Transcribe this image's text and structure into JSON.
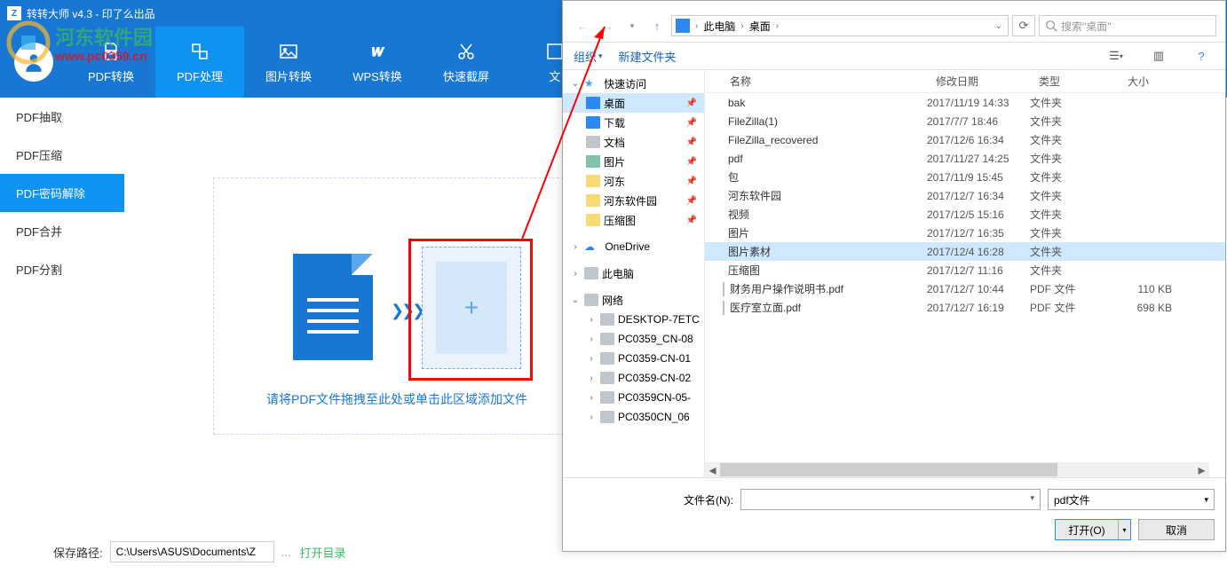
{
  "app": {
    "title": "转转大师 v4.3 - 印了么出品",
    "watermark_site": "河东软件园",
    "watermark_url": "www.pc0359.cn"
  },
  "topnav": [
    {
      "label": "PDF转换",
      "key": "pdf-convert"
    },
    {
      "label": "PDF处理",
      "key": "pdf-process",
      "active": true
    },
    {
      "label": "图片转换",
      "key": "img-convert"
    },
    {
      "label": "WPS转换",
      "key": "wps-convert"
    },
    {
      "label": "快速截屏",
      "key": "snip"
    },
    {
      "label": "文",
      "key": "more"
    }
  ],
  "sidebar": [
    {
      "label": "PDF抽取",
      "key": "extract"
    },
    {
      "label": "PDF压缩",
      "key": "compress"
    },
    {
      "label": "PDF密码解除",
      "key": "decrypt",
      "active": true
    },
    {
      "label": "PDF合并",
      "key": "merge"
    },
    {
      "label": "PDF分割",
      "key": "split"
    }
  ],
  "dropzone": {
    "hint": "请将PDF文件拖拽至此处或单击此区域添加文件"
  },
  "footer": {
    "save_path_label": "保存路径:",
    "save_path_value": "C:\\Users\\ASUS\\Documents\\Z",
    "browse": "...",
    "open_dir": "打开目录"
  },
  "dialog": {
    "path_segments": [
      "此电脑",
      "桌面"
    ],
    "search_placeholder": "搜索\"桌面\"",
    "toolbar": {
      "organize": "组织",
      "new_folder": "新建文件夹"
    },
    "nav": {
      "quick_access": "快速访问",
      "quick_items": [
        {
          "label": "桌面",
          "sel": true,
          "icon": "blue"
        },
        {
          "label": "下载",
          "icon": "blue"
        },
        {
          "label": "文档",
          "icon": "gray"
        },
        {
          "label": "图片",
          "icon": "img"
        },
        {
          "label": "河东",
          "icon": "folder"
        },
        {
          "label": "河东软件园",
          "icon": "folder"
        },
        {
          "label": "压缩图",
          "icon": "folder"
        }
      ],
      "onedrive": "OneDrive",
      "this_pc": "此电脑",
      "network": "网络",
      "net_items": [
        "DESKTOP-7ETC",
        "PC0359_CN-08",
        "PC0359-CN-01",
        "PC0359-CN-02",
        "PC0359CN-05-",
        "PC0350CN_06"
      ]
    },
    "columns": {
      "name": "名称",
      "date": "修改日期",
      "type": "类型",
      "size": "大小"
    },
    "files": [
      {
        "name": "bak",
        "date": "2017/11/19 14:33",
        "type": "文件夹",
        "size": ""
      },
      {
        "name": "FileZilla(1)",
        "date": "2017/7/7 18:46",
        "type": "文件夹",
        "size": ""
      },
      {
        "name": "FileZilla_recovered",
        "date": "2017/12/6 16:34",
        "type": "文件夹",
        "size": ""
      },
      {
        "name": "pdf",
        "date": "2017/11/27 14:25",
        "type": "文件夹",
        "size": ""
      },
      {
        "name": "包",
        "date": "2017/11/9 15:45",
        "type": "文件夹",
        "size": ""
      },
      {
        "name": "河东软件园",
        "date": "2017/12/7 16:34",
        "type": "文件夹",
        "size": ""
      },
      {
        "name": "视频",
        "date": "2017/12/5 15:16",
        "type": "文件夹",
        "size": ""
      },
      {
        "name": "图片",
        "date": "2017/12/7 16:35",
        "type": "文件夹",
        "size": ""
      },
      {
        "name": "图片素材",
        "date": "2017/12/4 16:28",
        "type": "文件夹",
        "size": "",
        "sel": true
      },
      {
        "name": "压缩图",
        "date": "2017/12/7 11:16",
        "type": "文件夹",
        "size": ""
      },
      {
        "name": "财务用户操作说明书.pdf",
        "date": "2017/12/7 10:44",
        "type": "PDF 文件",
        "size": "110 KB",
        "pdf": true
      },
      {
        "name": "医疗室立面.pdf",
        "date": "2017/12/7 16:19",
        "type": "PDF 文件",
        "size": "698 KB",
        "pdf": true
      }
    ],
    "filename_label": "文件名(N):",
    "filter": "pdf文件",
    "open_btn": "打开(O)",
    "cancel_btn": "取消"
  }
}
